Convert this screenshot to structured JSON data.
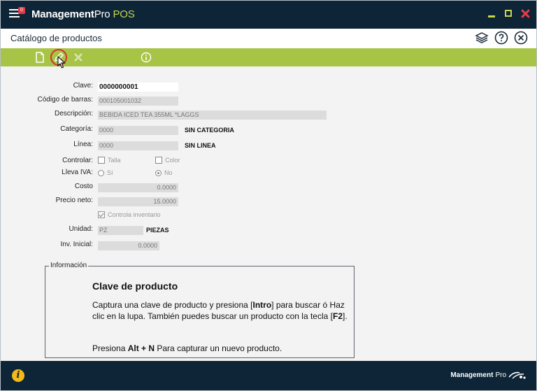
{
  "titlebar": {
    "app_name_bold": "Management",
    "app_name_light": "Pro",
    "app_name_suffix": "POS",
    "notification_count": "0",
    "colors": {
      "bar": "#0d2537",
      "accent": "#c8d749",
      "close": "#e23b4a"
    }
  },
  "header": {
    "title": "Catálogo de productos",
    "icons": [
      "layers-icon",
      "help-icon",
      "close-circle-icon"
    ]
  },
  "toolbar": {
    "color": "#a8c446",
    "buttons": [
      "new-document-icon",
      "edit-pencil-icon",
      "cancel-x-icon",
      "info-icon"
    ]
  },
  "form": {
    "clave": {
      "label": "Clave:",
      "value": "0000000001"
    },
    "codigo_barras": {
      "label": "Código de barras:",
      "value": "000105001032"
    },
    "descripcion": {
      "label": "Descripción:",
      "value": "BEBIDA ICED TEA 355ML *LAGGS"
    },
    "categoria": {
      "label": "Categoría:",
      "value": "0000",
      "desc": "SIN CATEGORIA"
    },
    "linea": {
      "label": "Línea:",
      "value": "0000",
      "desc": "SIN LINEA"
    },
    "controlar": {
      "label": "Controlar:",
      "opt1": "Talla",
      "opt2": "Color"
    },
    "lleva_iva": {
      "label": "Lleva IVA:",
      "opt1": "Sí",
      "opt2": "No",
      "selected": "No"
    },
    "costo": {
      "label": "Costo",
      "value": "0.0000"
    },
    "precio_neto": {
      "label": "Precio neto:",
      "value": "15.0000"
    },
    "controla_inventario": {
      "label": "Controla inventario",
      "checked": true
    },
    "unidad": {
      "label": "Unidad:",
      "value": "PZ",
      "desc": "PIEZAS"
    },
    "inv_inicial": {
      "label": "Inv. Inicial:",
      "value": "0.0000"
    }
  },
  "info": {
    "legend": "Información",
    "title": "Clave de producto",
    "p1_a": "Captura una clave de producto y presiona [",
    "p1_b": "Intro",
    "p1_c": "] para buscar ó Haz clic en la lupa.  También puedes buscar un producto con la tecla [",
    "p1_d": "F2",
    "p1_e": "].",
    "p2_a": "Presiona ",
    "p2_b": "Alt + N",
    "p2_c": " Para capturar un nuevo producto."
  },
  "footer": {
    "info_glyph": "i",
    "logo_bold": "Management",
    "logo_light": "Pro"
  }
}
